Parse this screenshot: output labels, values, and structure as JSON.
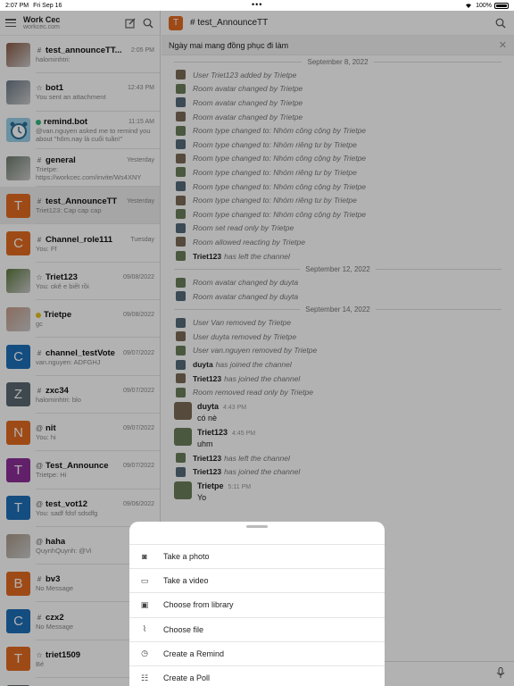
{
  "status_bar": {
    "time": "2:07 PM",
    "date": "Fri Sep 16",
    "battery": "100%"
  },
  "sidebar": {
    "server_name": "Work Cec",
    "server_url": "workcec.com",
    "rooms": [
      {
        "name": "test_announceTT...",
        "time": "2:05 PM",
        "sub": "halominhtri:",
        "type": "#",
        "avatar_kind": "photo",
        "avatar_color": "#8a5a44"
      },
      {
        "name": "bot1",
        "time": "12:43 PM",
        "sub": "You sent an attachment",
        "type": "☆",
        "avatar_kind": "photo",
        "avatar_color": "#6b7a86"
      },
      {
        "name": "remind.bot",
        "time": "11:15 AM",
        "sub": "@van.nguyen asked me to remind you about \"hôm.nay là cuối tuần!\"",
        "type": "dot",
        "status_color": "#2eb67d",
        "avatar_kind": "clock",
        "avatar_color": "#9ad0e8"
      },
      {
        "name": "general",
        "time": "Yesterday",
        "sub": "Trietpe: https://workcec.com/invite/Ws4XNY",
        "type": "#",
        "avatar_kind": "photo",
        "avatar_color": "#6e7b6d"
      },
      {
        "name": "test_AnnounceTT",
        "time": "Yesterday",
        "sub": "Triet123: Cap cap cap",
        "type": "#",
        "avatar_kind": "letter",
        "letter": "T",
        "avatar_color": "#e36b21",
        "active": true
      },
      {
        "name": "Channel_role111",
        "time": "Tuesday",
        "sub": "You: Ff",
        "type": "#",
        "avatar_kind": "letter",
        "letter": "C",
        "avatar_color": "#e36b21"
      },
      {
        "name": "Triet123",
        "time": "09/08/2022",
        "sub": "You: okê e biết rồi",
        "type": "☆",
        "avatar_kind": "photo",
        "avatar_color": "#5d7a3e"
      },
      {
        "name": "Trietpe",
        "time": "09/08/2022",
        "sub": "gc",
        "type": "dot",
        "status_color": "#e8c11c",
        "avatar_kind": "photo",
        "avatar_color": "#c69c8a"
      },
      {
        "name": "channel_testVote",
        "time": "09/07/2022",
        "sub": "van.nguyen: ADFGHJ",
        "type": "#",
        "avatar_kind": "letter",
        "letter": "C",
        "avatar_color": "#1d6fb8"
      },
      {
        "name": "zxc34",
        "time": "09/07/2022",
        "sub": "halominhtri: blo",
        "type": "#",
        "avatar_kind": "letter",
        "letter": "Z",
        "avatar_color": "#5a6770"
      },
      {
        "name": "nit",
        "time": "09/07/2022",
        "sub": "You: hi",
        "type": "@",
        "avatar_kind": "letter",
        "letter": "N",
        "avatar_color": "#e36b21"
      },
      {
        "name": "Test_Announce",
        "time": "09/07/2022",
        "sub": "Trietpe: Hi",
        "type": "@",
        "avatar_kind": "letter",
        "letter": "T",
        "avatar_color": "#8b2f97"
      },
      {
        "name": "test_vot12",
        "time": "09/06/2022",
        "sub": "You: sadf fdsf sdsdfg",
        "type": "@",
        "avatar_kind": "letter",
        "letter": "T",
        "avatar_color": "#1d6fb8"
      },
      {
        "name": "haha",
        "time": "",
        "sub": "QuynhQuynh: @Vi",
        "type": "@",
        "avatar_kind": "photo",
        "avatar_color": "#a99a8a"
      },
      {
        "name": "bv3",
        "time": "",
        "sub": "No Message",
        "type": "#",
        "avatar_kind": "letter",
        "letter": "B",
        "avatar_color": "#e36b21"
      },
      {
        "name": "czx2",
        "time": "",
        "sub": "No Message",
        "type": "#",
        "avatar_kind": "letter",
        "letter": "C",
        "avatar_color": "#1d6fb8"
      },
      {
        "name": "triet1509",
        "time": "",
        "sub": "Bé",
        "type": "☆",
        "avatar_kind": "letter",
        "letter": "T",
        "avatar_color": "#e36b21"
      },
      {
        "name": "zzz",
        "time": "",
        "sub": "",
        "type": "#",
        "avatar_kind": "letter",
        "letter": "Z",
        "avatar_color": "#5a6770"
      }
    ]
  },
  "main": {
    "room_letter": "T",
    "title": "# test_AnnounceTT",
    "announcement": "Ngày mai mang đồng phục đi làm",
    "sections": [
      {
        "date": "September 8, 2022",
        "items": [
          {
            "kind": "sys",
            "text": "User Triet123 added by Trietpe"
          },
          {
            "kind": "sys",
            "text": "Room avatar changed by Trietpe"
          },
          {
            "kind": "sys",
            "text": "Room avatar changed by Trietpe"
          },
          {
            "kind": "sys",
            "text": "Room avatar changed by Trietpe"
          },
          {
            "kind": "sys",
            "text": "Room type changed to: Nhóm công cộng by Trietpe"
          },
          {
            "kind": "sys",
            "text": "Room type changed to: Nhóm riêng tư by Trietpe"
          },
          {
            "kind": "sys",
            "text": "Room type changed to: Nhóm công cộng by Trietpe"
          },
          {
            "kind": "sys",
            "text": "Room type changed to: Nhóm riêng tư by Trietpe"
          },
          {
            "kind": "sys",
            "text": "Room type changed to: Nhóm công cộng by Trietpe"
          },
          {
            "kind": "sys",
            "text": "Room type changed to: Nhóm riêng tư by Trietpe"
          },
          {
            "kind": "sys",
            "text": "Room type changed to: Nhóm công cộng by Trietpe"
          },
          {
            "kind": "sys",
            "text": "Room set read only by Trietpe"
          },
          {
            "kind": "sys",
            "text": "Room allowed reacting by Trietpe"
          },
          {
            "kind": "sys",
            "user": "Triet123",
            "text": "has left the channel"
          }
        ]
      },
      {
        "date": "September 12, 2022",
        "items": [
          {
            "kind": "sys",
            "text": "Room avatar changed by duyta"
          },
          {
            "kind": "sys",
            "text": "Room avatar changed by duyta"
          }
        ]
      },
      {
        "date": "September 14, 2022",
        "items": [
          {
            "kind": "sys",
            "text": "User Van removed by Trietpe"
          },
          {
            "kind": "sys",
            "text": "User duyta removed by Trietpe"
          },
          {
            "kind": "sys",
            "text": "User van.nguyen removed by Trietpe"
          },
          {
            "kind": "sys",
            "user": "duyta",
            "text": "has joined the channel"
          },
          {
            "kind": "sys",
            "user": "Triet123",
            "text": "has joined the channel"
          },
          {
            "kind": "sys",
            "text": "Room removed read only by Trietpe"
          },
          {
            "kind": "msg",
            "user": "duyta",
            "time": "4:43 PM",
            "text": "có nè"
          },
          {
            "kind": "msg",
            "user": "Triet123",
            "time": "4:45 PM",
            "text": "uhm"
          },
          {
            "kind": "sys",
            "user": "Triet123",
            "text": "has left the channel"
          },
          {
            "kind": "sys",
            "user": "Triet123",
            "text": "has joined the channel"
          },
          {
            "kind": "msg",
            "user": "Trietpe",
            "time": "5:11 PM",
            "text": "Yo"
          }
        ]
      }
    ]
  },
  "action_sheet": {
    "items": [
      {
        "icon": "camera-icon",
        "glyph": "◙",
        "label": "Take a photo"
      },
      {
        "icon": "video-icon",
        "glyph": "▭",
        "label": "Take a video"
      },
      {
        "icon": "image-icon",
        "glyph": "▣",
        "label": "Choose from library"
      },
      {
        "icon": "paperclip-icon",
        "glyph": "⌇",
        "label": "Choose file"
      },
      {
        "icon": "clock-icon",
        "glyph": "◷",
        "label": "Create a Remind"
      },
      {
        "icon": "poll-icon",
        "glyph": "☷",
        "label": "Create a Poll"
      }
    ]
  }
}
